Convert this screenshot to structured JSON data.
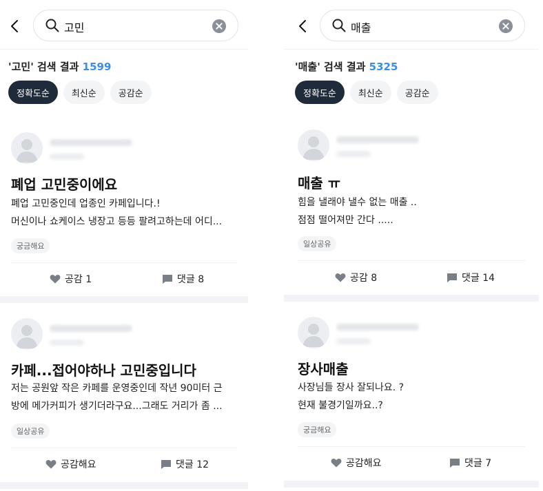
{
  "colors": {
    "accent": "#3b8de6",
    "chip_active": "#1f2a3a",
    "chip": "#f3f4f6"
  },
  "left": {
    "query": "고민",
    "result_label": "'고민' 검색 결과",
    "result_count": "1599",
    "sorts": [
      "정확도순",
      "최신순",
      "공감순"
    ],
    "posts": [
      {
        "title": "폐업 고민중이에요",
        "lines": [
          "폐업 고민중인데 업종인 카페입니다.!",
          "머신이나 쇼케이스 냉장고 등등 팔려고하는데 어디..."
        ],
        "tag": "궁금해요",
        "like": "공감 1",
        "comment": "댓글 8"
      },
      {
        "title": "카페...접어야하나 고민중입니다",
        "lines": [
          "저는 공원앞 작은 카페를 운영중인데 작년 90미터 근",
          "방에 메가커피가 생기더라구요...그래도 거리가 좀 ..."
        ],
        "tag": "일상공유",
        "like": "공감해요",
        "comment": "댓글 12"
      }
    ]
  },
  "right": {
    "query": "매출",
    "result_label": "'매출' 검색 결과",
    "result_count": "5325",
    "sorts": [
      "정확도순",
      "최신순",
      "공감순"
    ],
    "posts": [
      {
        "title": "매출 ㅠ",
        "lines": [
          "힘을 낼래야 낼수 없는 매출 ..",
          "점점 떨어져만 간다 ....."
        ],
        "tag": "일상공유",
        "like": "공감 8",
        "comment": "댓글 14"
      },
      {
        "title": "장사매출",
        "lines": [
          "사장님들 장사 잘되나요. ?",
          "현재 불경기일까요..?"
        ],
        "tag": "궁금해요",
        "like": "공감해요",
        "comment": "댓글 7"
      }
    ]
  },
  "icons": [
    "chevron-left-icon",
    "search-icon",
    "clear-icon",
    "avatar-icon",
    "heart-icon",
    "comment-icon"
  ]
}
